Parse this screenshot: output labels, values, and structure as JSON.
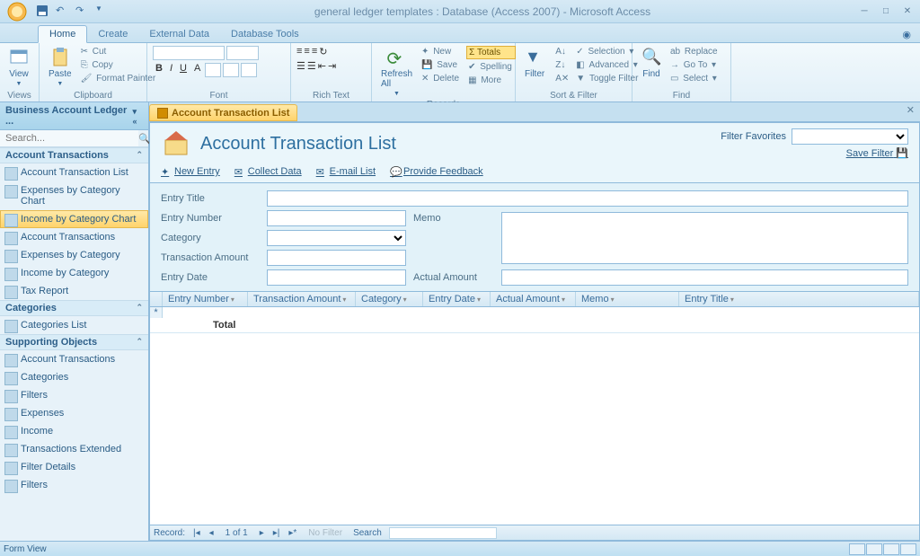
{
  "titlebar": {
    "title": "general ledger templates : Database (Access 2007) - Microsoft Access"
  },
  "ribbon": {
    "tabs": [
      "Home",
      "Create",
      "External Data",
      "Database Tools"
    ],
    "active_tab": 0,
    "groups": {
      "views": {
        "label": "Views",
        "view_btn": "View"
      },
      "clipboard": {
        "label": "Clipboard",
        "paste": "Paste",
        "cut": "Cut",
        "copy": "Copy",
        "fmt": "Format Painter"
      },
      "font": {
        "label": "Font"
      },
      "richtext": {
        "label": "Rich Text"
      },
      "records": {
        "label": "Records",
        "refresh": "Refresh All",
        "new": "New",
        "save": "Save",
        "delete": "Delete",
        "totals": "Σ Totals",
        "spelling": "Spelling",
        "more": "More"
      },
      "sortfilter": {
        "label": "Sort & Filter",
        "filter": "Filter",
        "selection": "Selection",
        "advanced": "Advanced",
        "toggle": "Toggle Filter"
      },
      "find": {
        "label": "Find",
        "find": "Find",
        "replace": "Replace",
        "goto": "Go To",
        "select": "Select"
      }
    }
  },
  "nav": {
    "title": "Business Account Ledger ...",
    "search_placeholder": "Search...",
    "cat1": "Account Transactions",
    "cat1_items": [
      "Account Transaction List",
      "Expenses by Category Chart",
      "Income by Category Chart",
      "Account Transactions",
      "Expenses by Category",
      "Income by Category",
      "Tax Report"
    ],
    "cat1_selected": 2,
    "cat2": "Categories",
    "cat2_items": [
      "Categories List"
    ],
    "cat3": "Supporting Objects",
    "cat3_items": [
      "Account Transactions",
      "Categories",
      "Filters",
      "Expenses",
      "Income",
      "Transactions Extended",
      "Filter Details",
      "Filters"
    ]
  },
  "doc": {
    "tab_title": "Account Transaction List",
    "form_title": "Account Transaction List",
    "filter_favorites": "Filter Favorites",
    "save_filter": "Save Filter",
    "links": {
      "new_entry": "New Entry",
      "collect": "Collect Data",
      "email": "E-mail List",
      "feedback": "Provide Feedback"
    },
    "labels": {
      "entry_title": "Entry Title",
      "entry_number": "Entry Number",
      "category": "Category",
      "trans_amount": "Transaction Amount",
      "entry_date": "Entry Date",
      "memo": "Memo",
      "actual_amount": "Actual Amount"
    },
    "grid_cols": [
      "Entry Number",
      "Transaction Amount",
      "Category",
      "Entry Date",
      "Actual Amount",
      "Memo",
      "Entry Title"
    ],
    "total_label": "Total",
    "record_nav": {
      "label": "Record:",
      "position": "1 of 1",
      "no_filter": "No Filter",
      "search": "Search"
    }
  },
  "statusbar": {
    "text": "Form View"
  }
}
